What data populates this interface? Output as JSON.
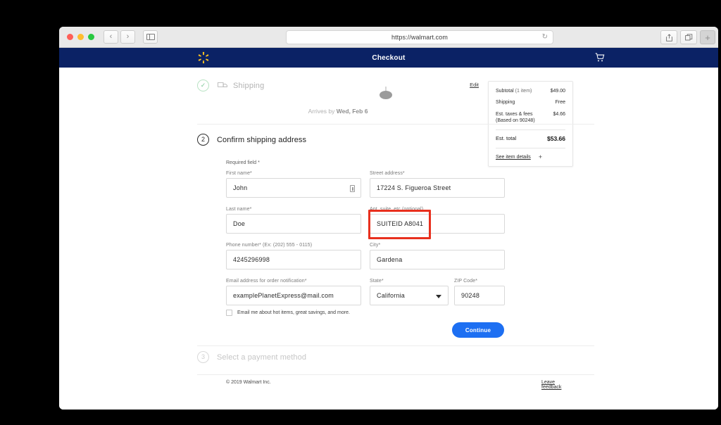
{
  "browser": {
    "url": "https://walmart.com",
    "traffic_lights": [
      "close",
      "minimize",
      "maximize"
    ],
    "back_glyph": "‹",
    "forward_glyph": "›",
    "reload_glyph": "↻",
    "share_glyph": "⇧",
    "tabs_glyph": "⧉",
    "newtab_glyph": "+"
  },
  "site_header": {
    "title": "Checkout",
    "logo_name": "walmart-spark-logo",
    "cart_name": "shopping-cart-icon",
    "bg_color": "#0b2265",
    "logo_color": "#ffc220"
  },
  "summary": {
    "rows": [
      {
        "label": "Subtotal",
        "qty": "(1 item)",
        "value": "$49.00"
      },
      {
        "label": "Shipping",
        "qty": "",
        "value": "Free"
      },
      {
        "label": "Est. taxes & fees",
        "qty": "",
        "sublabel": "(Based on 90248)",
        "value": "$4.66"
      }
    ],
    "total_label": "Est. total",
    "total_value": "$53.66",
    "see_details_label": "See item details",
    "see_details_plus": "+"
  },
  "steps": {
    "step1": {
      "label": "Shipping",
      "edit_label": "Edit",
      "check_glyph": "✓",
      "arrives_prefix": "Arrives by ",
      "arrives_date": "Wed, Feb 6"
    },
    "step2": {
      "number": "2",
      "label": "Confirm shipping address"
    },
    "step3": {
      "number": "3",
      "label": "Select a payment method"
    }
  },
  "form": {
    "required_note": "Required field *",
    "first_name": {
      "label": "First name*",
      "value": "John"
    },
    "last_name": {
      "label": "Last name*",
      "value": "Doe"
    },
    "phone": {
      "label": "Phone number* (Ex: (202) 555 - 0115)",
      "value": "4245296998"
    },
    "email": {
      "label": "Email address for order notification*",
      "value": "examplePlanetExpress@mail.com"
    },
    "street": {
      "label": "Street address*",
      "value": "17224 S. Figueroa Street"
    },
    "apt": {
      "label": "Apt, suite, etc (optional)",
      "value": "SUITEID A8041"
    },
    "city": {
      "label": "City*",
      "value": "Gardena"
    },
    "state": {
      "label": "State*",
      "value": "California"
    },
    "zip": {
      "label": "ZIP Code*",
      "value": "90248"
    },
    "optin_label": "Email me about hot items, great savings, and more.",
    "continue_label": "Continue",
    "highlight_color": "#e8301e"
  },
  "footer": {
    "copyright": "© 2019 Walmart Inc.",
    "feedback_label": "Leave feedback"
  }
}
